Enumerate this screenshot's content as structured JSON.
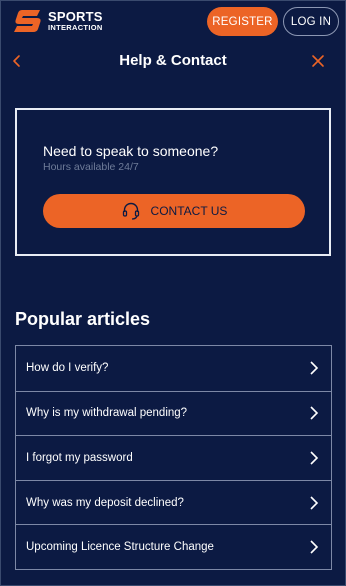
{
  "brand": {
    "line1": "SPORTS",
    "line2": "INTERACTION",
    "accent_color": "#ec6426",
    "background_color": "#0c1a43"
  },
  "topbar": {
    "register_label": "REGISTER",
    "login_label": "LOG IN"
  },
  "header": {
    "title": "Help & Contact",
    "back_icon": "chevron-left-icon",
    "close_icon": "close-icon"
  },
  "contact": {
    "heading": "Need to speak to someone?",
    "subtext": "Hours available 24/7",
    "button_label": "CONTACT US",
    "button_icon": "headset-icon"
  },
  "popular": {
    "title": "Popular articles",
    "items": [
      {
        "label": "How do I verify?"
      },
      {
        "label": "Why is my withdrawal pending?"
      },
      {
        "label": "I forgot my password"
      },
      {
        "label": "Why was my deposit declined?"
      },
      {
        "label": "Upcoming Licence Structure Change"
      }
    ]
  }
}
